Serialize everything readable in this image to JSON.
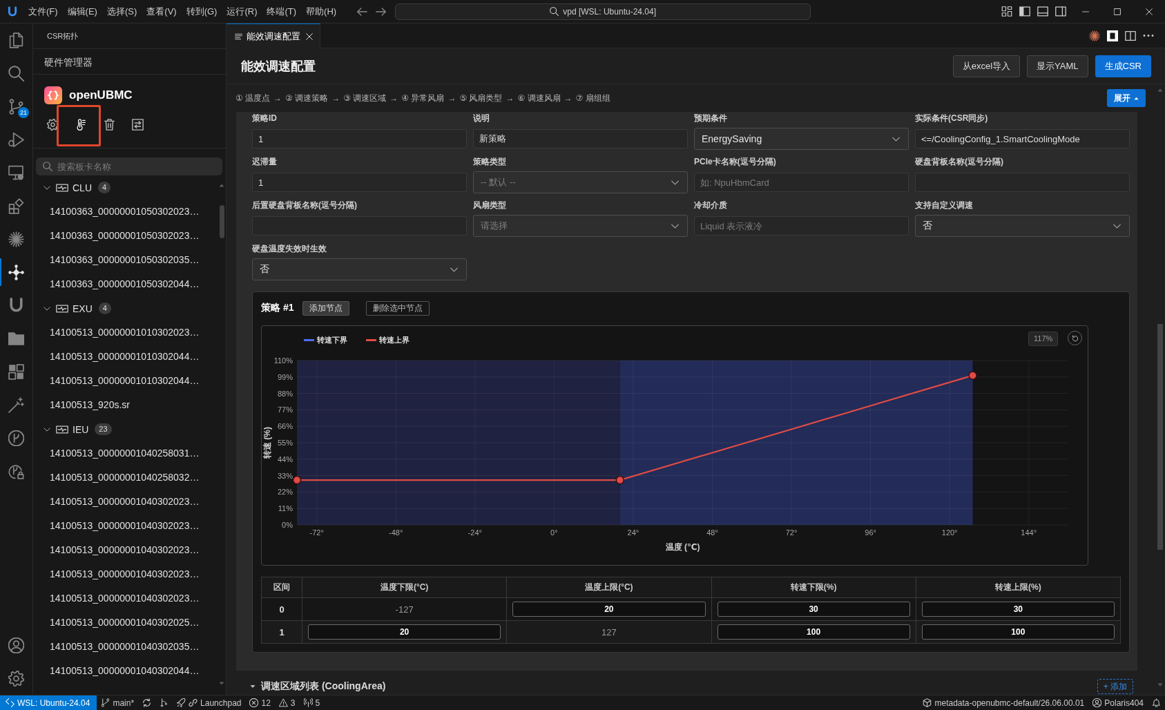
{
  "title_bar": {
    "menu": [
      "文件(F)",
      "编辑(E)",
      "选择(S)",
      "查看(V)",
      "转到(G)",
      "运行(R)",
      "终端(T)",
      "帮助(H)"
    ],
    "search": {
      "label": "vpd [WSL: Ubuntu-24.04]"
    }
  },
  "activity_bar": {
    "items": [
      {
        "kind": "files",
        "selected": false
      },
      {
        "kind": "search",
        "selected": false
      },
      {
        "kind": "source-control",
        "selected": false,
        "badge": "21"
      },
      {
        "kind": "run-debug",
        "selected": false
      },
      {
        "kind": "remote",
        "selected": false
      },
      {
        "kind": "extensions",
        "selected": false
      },
      {
        "kind": "starburst",
        "selected": false
      },
      {
        "kind": "nodes",
        "selected": true
      },
      {
        "kind": "magnet",
        "selected": false
      },
      {
        "kind": "folder",
        "selected": false
      },
      {
        "kind": "blocks",
        "selected": false
      },
      {
        "kind": "wand",
        "selected": false
      },
      {
        "kind": "git-graph",
        "selected": false
      },
      {
        "kind": "lock-graph",
        "selected": false
      }
    ],
    "bottom": [
      {
        "kind": "account"
      },
      {
        "kind": "settings"
      }
    ]
  },
  "sidebar": {
    "title": "CSR拓扑",
    "section": "硬件管理器",
    "product": "openUBMC",
    "tools": [
      {
        "kind": "gear",
        "highlighted": false
      },
      {
        "kind": "thermometer",
        "highlighted": true
      },
      {
        "kind": "trash",
        "highlighted": false
      },
      {
        "kind": "list",
        "highlighted": false
      }
    ],
    "search": {
      "placeholder": "搜索板卡名称"
    },
    "tree": [
      {
        "label": "CLU",
        "count": "4",
        "expanded": true,
        "children": [
          {
            "label": "14100363_00000001050302023…"
          },
          {
            "label": "14100363_00000001050302023…"
          },
          {
            "label": "14100363_00000001050302035…"
          },
          {
            "label": "14100363_00000001050302044…"
          }
        ]
      },
      {
        "label": "EXU",
        "count": "4",
        "expanded": true,
        "children": [
          {
            "label": "14100513_00000001010302023…"
          },
          {
            "label": "14100513_00000001010302044…"
          },
          {
            "label": "14100513_00000001010302044…"
          },
          {
            "label": "14100513_920s.sr"
          }
        ]
      },
      {
        "label": "IEU",
        "count": "23",
        "expanded": true,
        "children": [
          {
            "label": "14100513_00000001040258031…"
          },
          {
            "label": "14100513_00000001040258032…"
          },
          {
            "label": "14100513_00000001040302023…"
          },
          {
            "label": "14100513_00000001040302023…"
          },
          {
            "label": "14100513_00000001040302023…"
          },
          {
            "label": "14100513_00000001040302023…"
          },
          {
            "label": "14100513_00000001040302023…"
          },
          {
            "label": "14100513_00000001040302025…"
          },
          {
            "label": "14100513_00000001040302035…"
          },
          {
            "label": "14100513_00000001040302044…"
          }
        ]
      }
    ]
  },
  "editor": {
    "tabs": [
      {
        "label": "能效调速配置",
        "selected": true
      }
    ],
    "title": "能效调速配置",
    "buttons": [
      {
        "label": "从excel导入",
        "kind": "secondary"
      },
      {
        "label": "显示YAML",
        "kind": "secondary"
      },
      {
        "label": "生成CSR",
        "kind": "primary"
      }
    ],
    "steps": [
      "① 温度点",
      "② 调速策略",
      "③ 调速区域",
      "④ 异常风扇",
      "⑤ 风扇类型",
      "⑥ 调速风扇",
      "⑦ 扇组组"
    ],
    "step_separator": "→",
    "expand_button": "展开",
    "form": [
      {
        "label": "策略ID",
        "kind": "input",
        "value": "1"
      },
      {
        "label": "说明",
        "kind": "input",
        "value": "新策略"
      },
      {
        "label": "预期条件",
        "kind": "select",
        "value": "EnergySaving"
      },
      {
        "label": "实际条件(CSR同步)",
        "kind": "input",
        "value": "<=/CoolingConfig_1.SmartCoolingMode"
      },
      {
        "label": "迟滞量",
        "kind": "input",
        "value": "1"
      },
      {
        "label": "策略类型",
        "kind": "select",
        "placeholder": "-- 默认 --"
      },
      {
        "label": "PCIe卡名称(逗号分隔)",
        "kind": "input",
        "placeholder": "如: NpuHbmCard"
      },
      {
        "label": "硬盘背板名称(逗号分隔)",
        "kind": "input"
      },
      {
        "label": "后置硬盘背板名称(逗号分隔)",
        "kind": "input"
      },
      {
        "label": "风扇类型",
        "kind": "select",
        "placeholder": "请选择"
      },
      {
        "label": "冷却介质",
        "kind": "input",
        "placeholder": "Liquid 表示液冷"
      },
      {
        "label": "支持自定义调速",
        "kind": "select",
        "value": "否"
      },
      {
        "label": "硬盘温度失效时生效",
        "kind": "select",
        "value": "否"
      }
    ],
    "strategy": {
      "title": "策略 #1",
      "buttons": [
        {
          "label": "添加节点",
          "kind": "filled"
        },
        {
          "label": "删除选中节点",
          "kind": "outline"
        }
      ],
      "chart": {
        "zoom_label": "117%",
        "chart_data": {
          "type": "line",
          "xlabel": "温度 (℃)",
          "ylabel": "转速 (%)",
          "x": [
            -78,
            20,
            127
          ],
          "series": [
            {
              "name": "转速下界",
              "color": "#4f6ef7",
              "values": [
                null,
                null,
                null
              ]
            },
            {
              "name": "转速上界",
              "color": "#e04b45",
              "values": [
                30,
                30,
                100
              ],
              "marker": "circle"
            }
          ],
          "xlim": [
            -78,
            156
          ],
          "ylim": [
            0,
            110
          ],
          "xticks": [
            {
              "value": -72,
              "label": "-72°"
            },
            {
              "value": -48,
              "label": "-48°"
            },
            {
              "value": -24,
              "label": "-24°"
            },
            {
              "value": 0,
              "label": "0°"
            },
            {
              "value": 24,
              "label": "24°"
            },
            {
              "value": 48,
              "label": "48°"
            },
            {
              "value": 72,
              "label": "72°"
            },
            {
              "value": 96,
              "label": "96°"
            },
            {
              "value": 120,
              "label": "120°"
            },
            {
              "value": 144,
              "label": "144°"
            }
          ],
          "yticks": [
            {
              "value": 0,
              "label": "0%"
            },
            {
              "value": 11,
              "label": "11%"
            },
            {
              "value": 22,
              "label": "22%"
            },
            {
              "value": 33,
              "label": "33%"
            },
            {
              "value": 44,
              "label": "44%"
            },
            {
              "value": 55,
              "label": "55%"
            },
            {
              "value": 66,
              "label": "66%"
            },
            {
              "value": 77,
              "label": "77%"
            },
            {
              "value": 88,
              "label": "88%"
            },
            {
              "value": 99,
              "label": "99%"
            },
            {
              "value": 110,
              "label": "110%"
            }
          ],
          "grid": true,
          "legend": true,
          "bands": [
            {
              "axis": "x",
              "from": -78,
              "to": 20,
              "color": "#1f2241"
            },
            {
              "axis": "x",
              "from": 20,
              "to": 127,
              "color": "#232b58"
            }
          ]
        }
      },
      "table": {
        "columns": [
          "区间",
          "温度下限(°C)",
          "温度上限(°C)",
          "转速下限(%)",
          "转速上限(%)"
        ],
        "rows": [
          {
            "cells": [
              {
                "kind": "index",
                "value": "0"
              },
              {
                "kind": "text",
                "value": "-127"
              },
              {
                "kind": "input",
                "value": "20"
              },
              {
                "kind": "input",
                "value": "30"
              },
              {
                "kind": "input",
                "value": "30"
              }
            ]
          },
          {
            "cells": [
              {
                "kind": "index",
                "value": "1"
              },
              {
                "kind": "input",
                "value": "20"
              },
              {
                "kind": "text",
                "value": "127"
              },
              {
                "kind": "input",
                "value": "100"
              },
              {
                "kind": "input",
                "value": "100"
              }
            ]
          }
        ]
      }
    },
    "section": {
      "label": "调速区域列表 (CoolingArea)",
      "expanded": true,
      "add_button": "+ 添加"
    }
  },
  "status_bar": {
    "left": [
      {
        "kind": "remote",
        "text": "WSL: Ubuntu-24.04"
      },
      {
        "kind": "branch",
        "text": "main*"
      },
      {
        "kind": "sync"
      },
      {
        "kind": "graph"
      },
      {
        "kind": "launchpad",
        "text": "Launchpad"
      },
      {
        "kind": "errors",
        "text": "12"
      },
      {
        "kind": "warnings",
        "text": "3"
      },
      {
        "kind": "ports",
        "text": "5"
      }
    ],
    "right": [
      {
        "kind": "package",
        "text": "metadata-openubmc-default/26.06.00.01"
      },
      {
        "kind": "account",
        "text": "Polaris404"
      },
      {
        "kind": "bell"
      }
    ]
  }
}
